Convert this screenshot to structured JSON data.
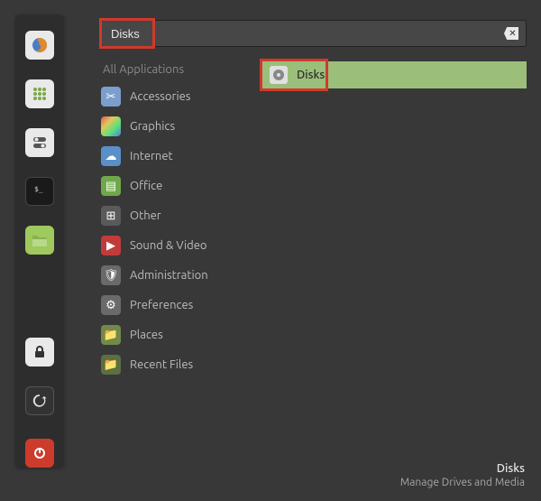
{
  "search": {
    "value": "Disks"
  },
  "categories": {
    "title": "All Applications",
    "items": [
      {
        "label": "Accessories",
        "icon": "scissors-icon"
      },
      {
        "label": "Graphics",
        "icon": "palette-icon"
      },
      {
        "label": "Internet",
        "icon": "cloud-icon"
      },
      {
        "label": "Office",
        "icon": "notebook-icon"
      },
      {
        "label": "Other",
        "icon": "grid-icon"
      },
      {
        "label": "Sound & Video",
        "icon": "play-icon"
      },
      {
        "label": "Administration",
        "icon": "shield-icon"
      },
      {
        "label": "Preferences",
        "icon": "sliders-icon"
      },
      {
        "label": "Places",
        "icon": "folder-icon"
      },
      {
        "label": "Recent Files",
        "icon": "folder-recent-icon"
      }
    ]
  },
  "results": [
    {
      "label": "Disks",
      "icon": "disk-icon"
    }
  ],
  "footer": {
    "title": "Disks",
    "desc": "Manage Drives and Media"
  },
  "sidebar": [
    {
      "name": "firefox-icon"
    },
    {
      "name": "apps-grid-icon"
    },
    {
      "name": "toggle-icon"
    },
    {
      "name": "terminal-icon"
    },
    {
      "name": "files-icon"
    },
    {
      "name": "lock-icon"
    },
    {
      "name": "update-icon"
    },
    {
      "name": "power-icon"
    }
  ],
  "highlights": {
    "search_box": true,
    "first_result": true
  }
}
